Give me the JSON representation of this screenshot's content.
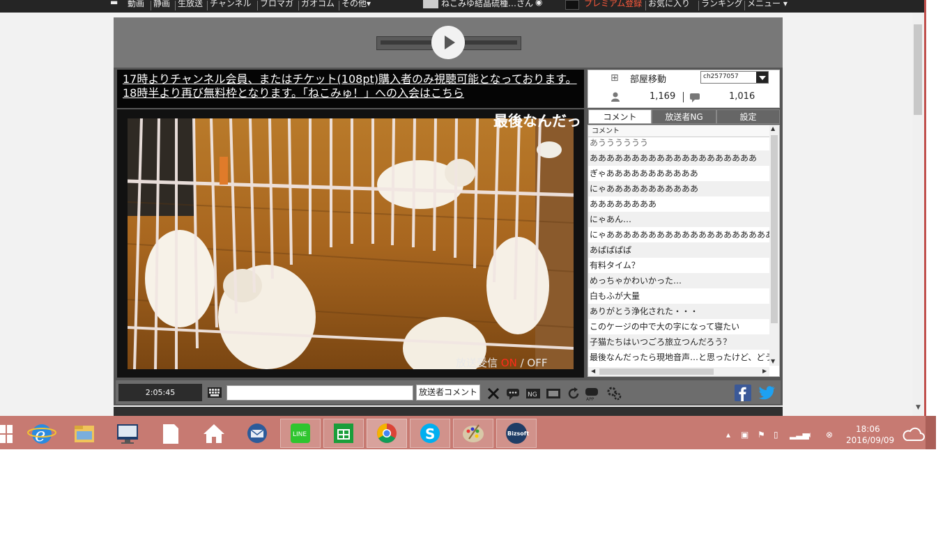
{
  "topbar": {
    "items": [
      "動画",
      "静画",
      "生放送",
      "チャンネル",
      "ブロマガ",
      "ガオコム",
      "その他▾"
    ],
    "user_name": "ねこみゆ結晶硫種…さん",
    "badge": "◉",
    "premium": "プレミアム登録",
    "favorites": "お気に入り",
    "ranking": "ランキング",
    "menu": "メニュー ▾"
  },
  "notice": {
    "line1": "17時よりチャンネル会員、またはチケット(108pt)購入者のみ視聴可能となっております。",
    "line2": "18時半より再び無料枠となります。「ねこみゅ！」への入会はこちら"
  },
  "video": {
    "telop": "最後なんだっ",
    "status_prefix": "放送受信 ",
    "status_on": "ON",
    "status_suffix": " / OFF"
  },
  "side": {
    "room_label": "部屋移動",
    "room_value": "ch2577057",
    "viewers": "1,169",
    "comments_count": "1,016"
  },
  "tabs": [
    "コメント",
    "放送者NG",
    "設定"
  ],
  "comment_header": "コメント",
  "comments": [
    "あうううううう",
    "ああああああああああああああああああああ",
    "ぎゃあああああああああああ",
    "にゃあああああああああああ",
    "ああああああああ",
    "にゃあん…",
    "にゃあああああああああああああああああああああああああああ",
    "あぱぱぱぱ",
    "有料タイム？",
    "めっちゃかわいかった…",
    "白もふが大量",
    "ありがとう浄化された・・・",
    "このケージの中で大の字になって寝たい",
    "子猫たちはいつごろ旅立つんだろう？",
    "最後なんだったら現地音声…と思ったけど、どうなんだろう"
  ],
  "controls": {
    "time": "2:05:45",
    "owner_comment": "放送者コメント"
  },
  "taskbar": {
    "time": "18:06",
    "date": "2016/09/09"
  },
  "colors": {
    "premium": "#ff5a3c",
    "status_on": "#ff2b1a",
    "taskbar": "#c77a72",
    "facebook": "#3b5998",
    "twitter": "#1da1f2"
  }
}
